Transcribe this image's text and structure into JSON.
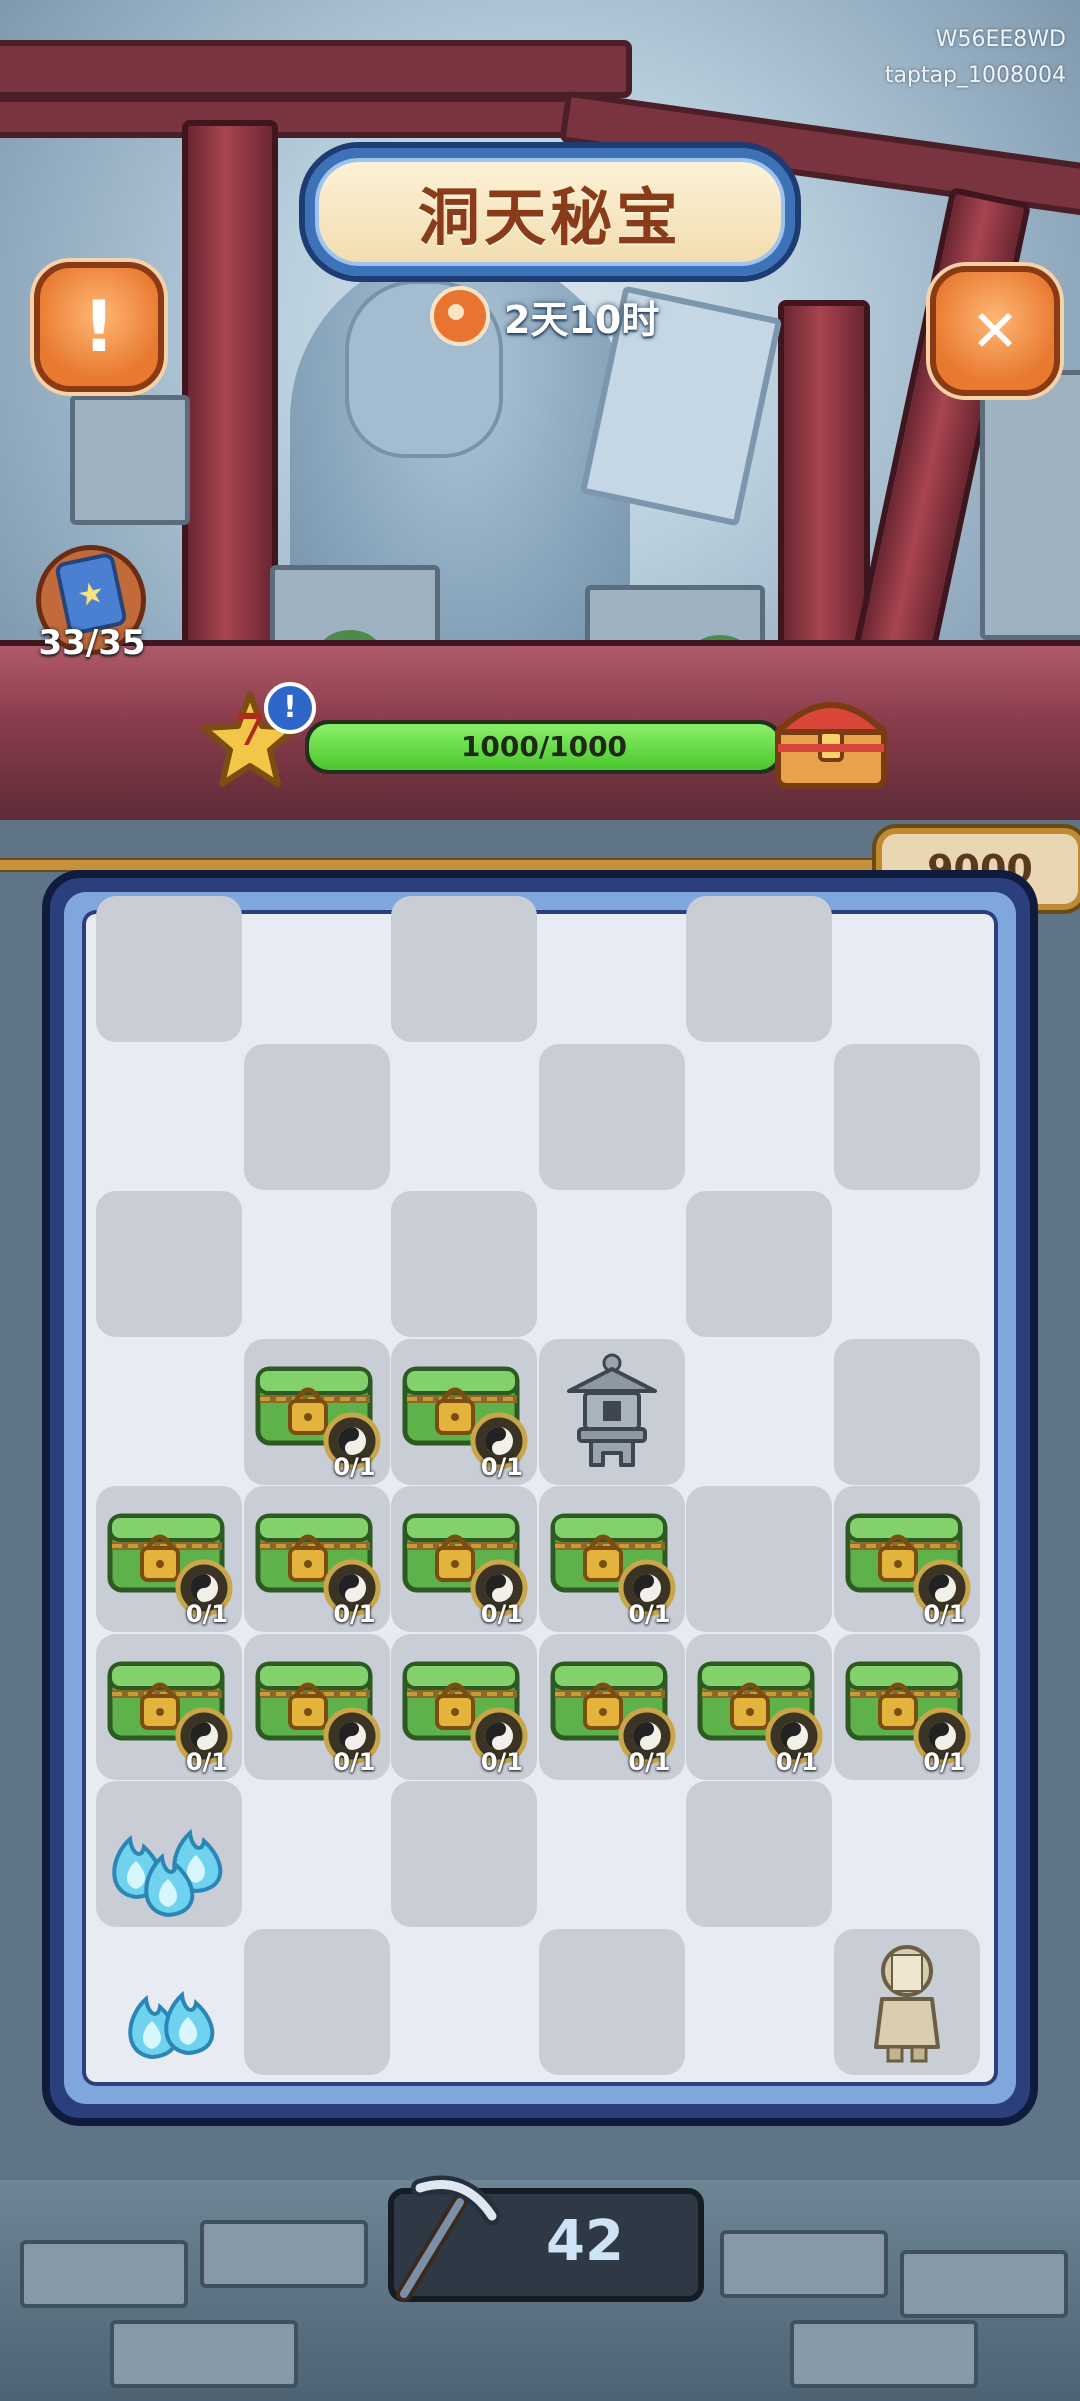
{
  "watermark": {
    "line1": "W56EE8WD",
    "line2": "taptap_1008004"
  },
  "header": {
    "title": "洞天秘宝",
    "timer": "2天10时"
  },
  "buttons": {
    "info": "!",
    "close": "✕"
  },
  "collection": {
    "count": "33/35"
  },
  "progress": {
    "level": "7",
    "alert": "!",
    "current": 1000,
    "max": 1000,
    "label": "1000/1000",
    "fraction": 1.0
  },
  "score": {
    "value": "9000"
  },
  "pickaxe": {
    "count": "42"
  },
  "board": {
    "rows": [
      [
        "dark",
        "empty",
        "dark",
        "empty",
        "dark",
        "empty"
      ],
      [
        "empty",
        "dark",
        "empty",
        "dark",
        "empty",
        "dark"
      ],
      [
        "dark",
        "empty",
        "dark",
        "empty",
        "dark",
        "empty"
      ],
      [
        "empty",
        "locked-chest",
        "locked-chest",
        "lantern",
        "empty",
        "dark"
      ],
      [
        "locked-chest",
        "locked-chest",
        "locked-chest",
        "locked-chest",
        "dark",
        "locked-chest"
      ],
      [
        "locked-chest",
        "locked-chest",
        "locked-chest",
        "locked-chest",
        "locked-chest",
        "locked-chest"
      ],
      [
        "blue-flames-3",
        "empty",
        "dark",
        "empty",
        "dark",
        "empty"
      ],
      [
        "blue-flames-2",
        "dark",
        "empty",
        "dark",
        "empty",
        "stone-figure"
      ]
    ],
    "chest_counter": "0/1"
  },
  "colors": {
    "progress_fill": "#4bc72e",
    "board_border": "#2c3f7d",
    "accent": "#e8792f"
  }
}
